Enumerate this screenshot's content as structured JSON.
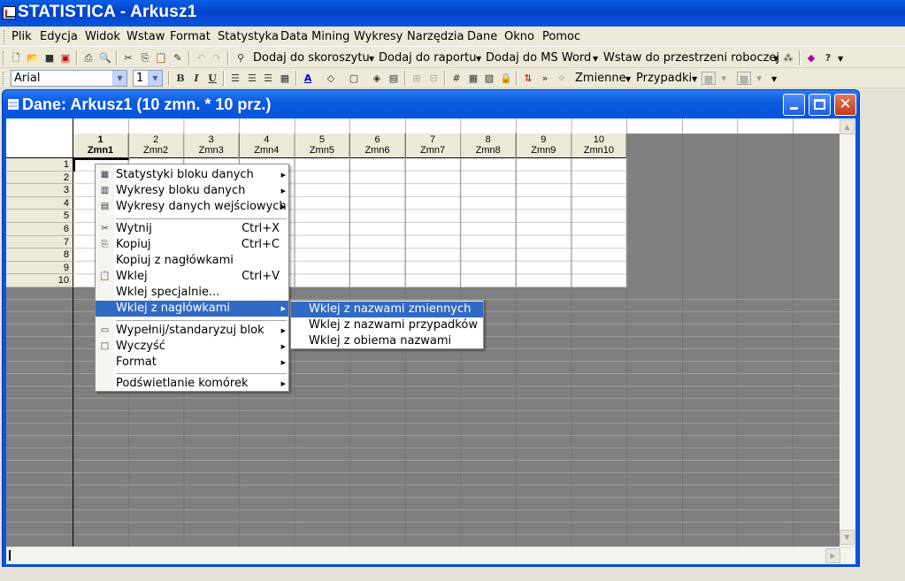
{
  "app": {
    "title": "STATISTICA - Arkusz1"
  },
  "menubar": [
    {
      "label": "Plik"
    },
    {
      "label": "Edycja"
    },
    {
      "label": "Widok"
    },
    {
      "label": "Wstaw"
    },
    {
      "label": "Format"
    },
    {
      "label": "Statystyka"
    },
    {
      "label": "Data Mining"
    },
    {
      "label": "Wykresy"
    },
    {
      "label": "Narzędzia"
    },
    {
      "label": "Dane"
    },
    {
      "label": "Okno"
    },
    {
      "label": "Pomoc"
    }
  ],
  "toolbar1": {
    "add_workbook": "Dodaj do skoroszytu",
    "add_report": "Dodaj do raportu",
    "add_word": "Dodaj do MS Word",
    "insert_workspace": "Wstaw do przestrzeni roboczej"
  },
  "toolbar2": {
    "font_name": "Arial",
    "font_size": "1",
    "bold": "B",
    "italic": "I",
    "underline": "U",
    "variables": "Zmienne",
    "cases": "Przypadki"
  },
  "window": {
    "title": "Dane: Arkusz1 (10 zmn. * 10 prz.)"
  },
  "sheet": {
    "columns": [
      {
        "num": "1",
        "name": "Zmn1"
      },
      {
        "num": "2",
        "name": "Zmn2"
      },
      {
        "num": "3",
        "name": "Zmn3"
      },
      {
        "num": "4",
        "name": "Zmn4"
      },
      {
        "num": "5",
        "name": "Zmn5"
      },
      {
        "num": "6",
        "name": "Zmn6"
      },
      {
        "num": "7",
        "name": "Zmn7"
      },
      {
        "num": "8",
        "name": "Zmn8"
      },
      {
        "num": "9",
        "name": "Zmn9"
      },
      {
        "num": "10",
        "name": "Zmn10"
      }
    ],
    "rows": [
      "1",
      "2",
      "3",
      "4",
      "5",
      "6",
      "7",
      "8",
      "9",
      "10"
    ]
  },
  "context_menu": {
    "items": [
      {
        "label": "Statystyki bloku danych",
        "icon": "table-stats-icon"
      },
      {
        "label": "Wykresy bloku danych",
        "icon": "chart-icon"
      },
      {
        "label": "Wykresy danych wejściowych",
        "icon": "chart-input-icon"
      },
      {
        "label": "Wytnij",
        "shortcut": "Ctrl+X",
        "icon": "scissors-icon"
      },
      {
        "label": "Kopiuj",
        "shortcut": "Ctrl+C",
        "icon": "copy-icon"
      },
      {
        "label": "Kopiuj z nagłówkami"
      },
      {
        "label": "Wklej",
        "shortcut": "Ctrl+V",
        "icon": "paste-icon"
      },
      {
        "label": "Wklej specjalnie..."
      },
      {
        "label": "Wklej z nagłówkami"
      },
      {
        "label": "Wypełnij/standaryzuj blok",
        "icon": "fill-icon"
      },
      {
        "label": "Wyczyść",
        "icon": "clear-icon"
      },
      {
        "label": "Format"
      },
      {
        "label": "Podświetlanie komórek"
      }
    ]
  },
  "submenu": {
    "items": [
      {
        "label": "Wklej z nazwami zmiennych"
      },
      {
        "label": "Wklej z nazwami przypadków"
      },
      {
        "label": "Wklej z obiema nazwami"
      }
    ]
  },
  "colors": {
    "highlight": "#316ac5",
    "titlebar": "#0a56dc",
    "sheet_gray": "#808080"
  }
}
